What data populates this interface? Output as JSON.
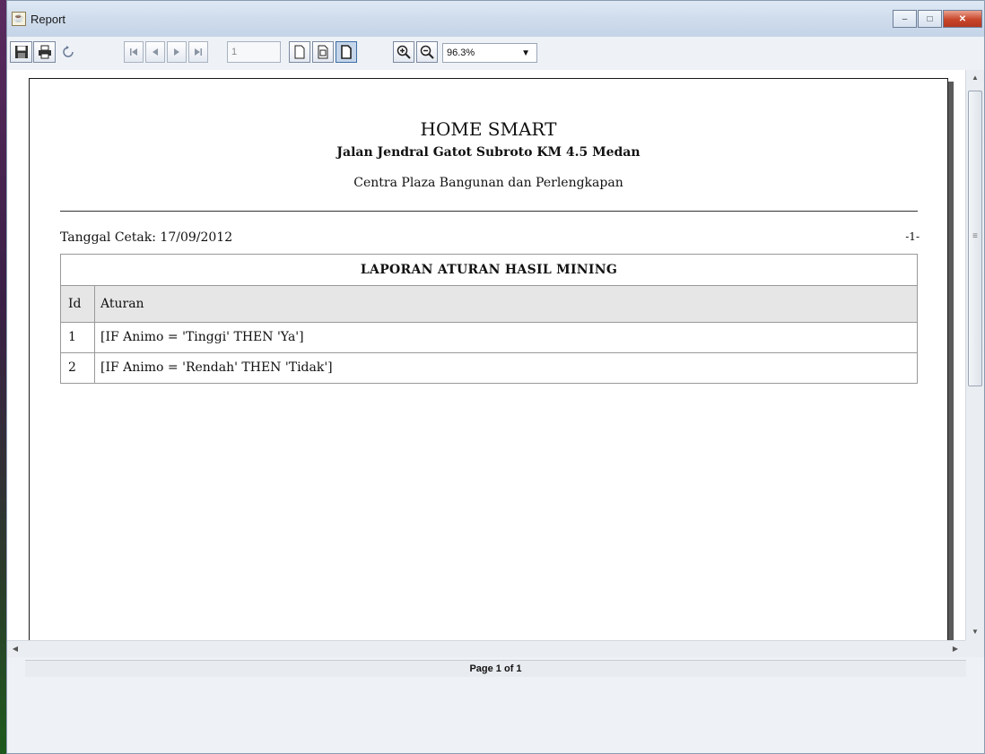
{
  "window": {
    "title": "Report",
    "controls": {
      "minimize": "–",
      "maximize": "□",
      "close": "✕"
    }
  },
  "toolbar": {
    "save_icon": "save-icon",
    "print_icon": "print-icon",
    "reload_icon": "reload-icon",
    "first_icon": "first-page-icon",
    "prev_icon": "previous-page-icon",
    "next_icon": "next-page-icon",
    "last_icon": "last-page-icon",
    "page_value": "1",
    "actual_size_icon": "actual-size-icon",
    "fit_page_icon": "fit-page-icon",
    "fit_width_icon": "fit-width-icon",
    "zoom_in_icon": "zoom-in-icon",
    "zoom_out_icon": "zoom-out-icon",
    "zoom_value": "96.3%"
  },
  "report": {
    "company": "HOME SMART",
    "address": "Jalan Jendral Gatot Subroto KM 4.5 Medan",
    "subtitle": "Centra Plaza Bangunan dan Perlengkapan",
    "print_date": "Tanggal Cetak: 17/09/2012",
    "page_number": "-1-",
    "table": {
      "title": "LAPORAN ATURAN HASIL MINING",
      "columns": [
        "Id",
        "Aturan"
      ],
      "rows": [
        [
          "1",
          "[IF Animo = 'Tinggi' THEN 'Ya']"
        ],
        [
          "2",
          "[IF Animo = 'Rendah' THEN 'Tidak']"
        ]
      ]
    }
  },
  "status": {
    "page_info": "Page 1 of 1"
  }
}
